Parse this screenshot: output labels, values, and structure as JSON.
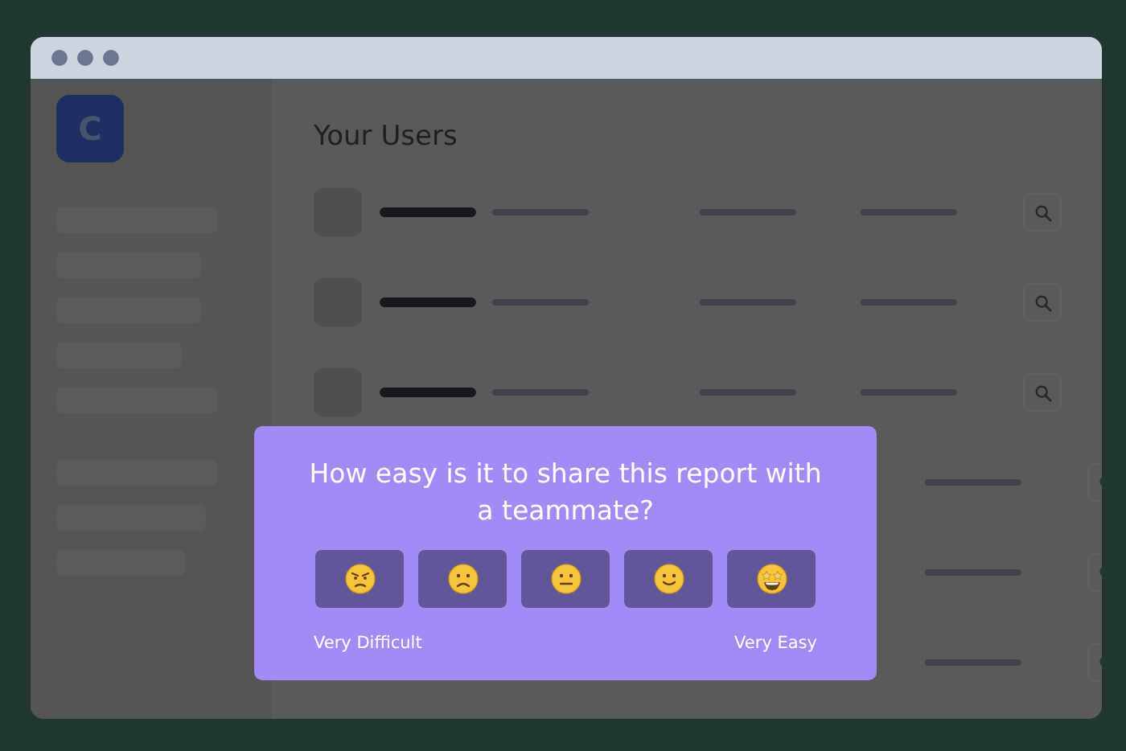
{
  "sidebar": {
    "logo": "C"
  },
  "main": {
    "heading": "Your Users"
  },
  "survey": {
    "question": "How easy is it to share this report with a teammate?",
    "options": [
      {
        "kind": "angry"
      },
      {
        "kind": "frown"
      },
      {
        "kind": "neutral"
      },
      {
        "kind": "smile"
      },
      {
        "kind": "starstruck"
      }
    ],
    "low_label": "Very Difficult",
    "high_label": "Very Easy"
  }
}
